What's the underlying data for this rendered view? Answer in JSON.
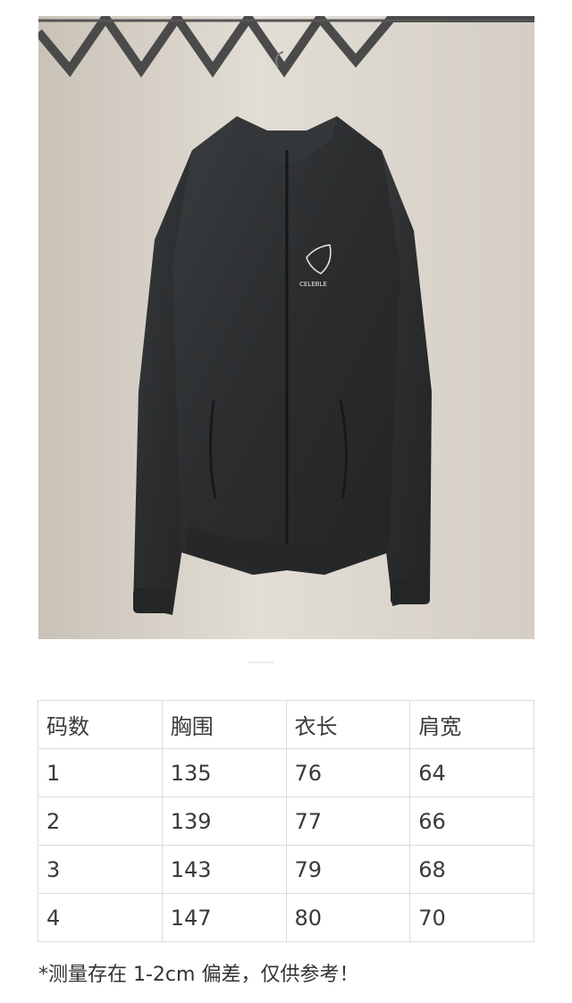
{
  "product": {
    "image_alt": "black zip-up jacket on hanger",
    "logo_text": "CELEBLE"
  },
  "size_table": {
    "headers": [
      "码数",
      "胸围",
      "衣长",
      "肩宽"
    ],
    "rows": [
      [
        "1",
        "135",
        "76",
        "64"
      ],
      [
        "2",
        "139",
        "77",
        "66"
      ],
      [
        "3",
        "143",
        "79",
        "68"
      ],
      [
        "4",
        "147",
        "80",
        "70"
      ]
    ]
  },
  "note": "*测量存在 1-2cm 偏差，仅供参考！",
  "colors": {
    "jacket": "#2c2e2f",
    "wall": "#d9d4cc",
    "table_border": "#dcdcdc"
  }
}
